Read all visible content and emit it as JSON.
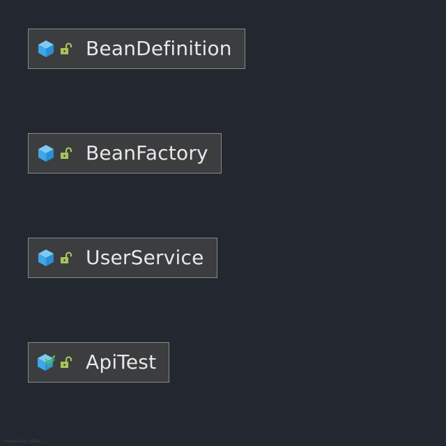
{
  "diagram": {
    "classes": [
      {
        "name": "BeanDefinition",
        "icon": "class-icon",
        "visibility": "unlock-icon"
      },
      {
        "name": "BeanFactory",
        "icon": "class-icon",
        "visibility": "unlock-icon"
      },
      {
        "name": "UserService",
        "icon": "class-icon",
        "visibility": "unlock-icon"
      },
      {
        "name": "ApiTest",
        "icon": "test-class-icon",
        "visibility": "unlock-icon"
      }
    ],
    "colors": {
      "background": "#222730",
      "box_fill": "#3c3d3f",
      "box_border": "#8a8a8a",
      "class_icon": "#3fa6e8",
      "lock_icon": "#a5c65a",
      "text": "#e8e8e8"
    }
  },
  "footer": {
    "credit": "Powered by yFiles"
  }
}
